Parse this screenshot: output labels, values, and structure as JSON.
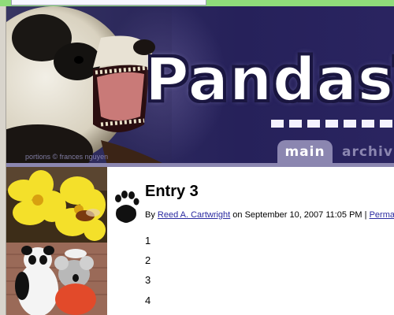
{
  "banner": {
    "title": "PandasT",
    "credit": "portions © frances nguyen",
    "tabs": [
      {
        "label": "main",
        "active": true
      },
      {
        "label": "archiv",
        "active": false
      }
    ]
  },
  "post": {
    "title": "Entry 3",
    "byline_prefix": "By",
    "author": "Reed A. Cartwright",
    "date_text": "on September 10, 2007 11:05 PM |",
    "permalink": "Permalin",
    "lines": [
      "1",
      "2",
      "3",
      "4"
    ]
  },
  "colors": {
    "banner_bg": "#2d2a5e",
    "tab_bg": "#8b86b0",
    "link": "#2a2aa0",
    "browser_bar": "#8fdc7a"
  },
  "icons": [
    "paw-print-icon"
  ]
}
